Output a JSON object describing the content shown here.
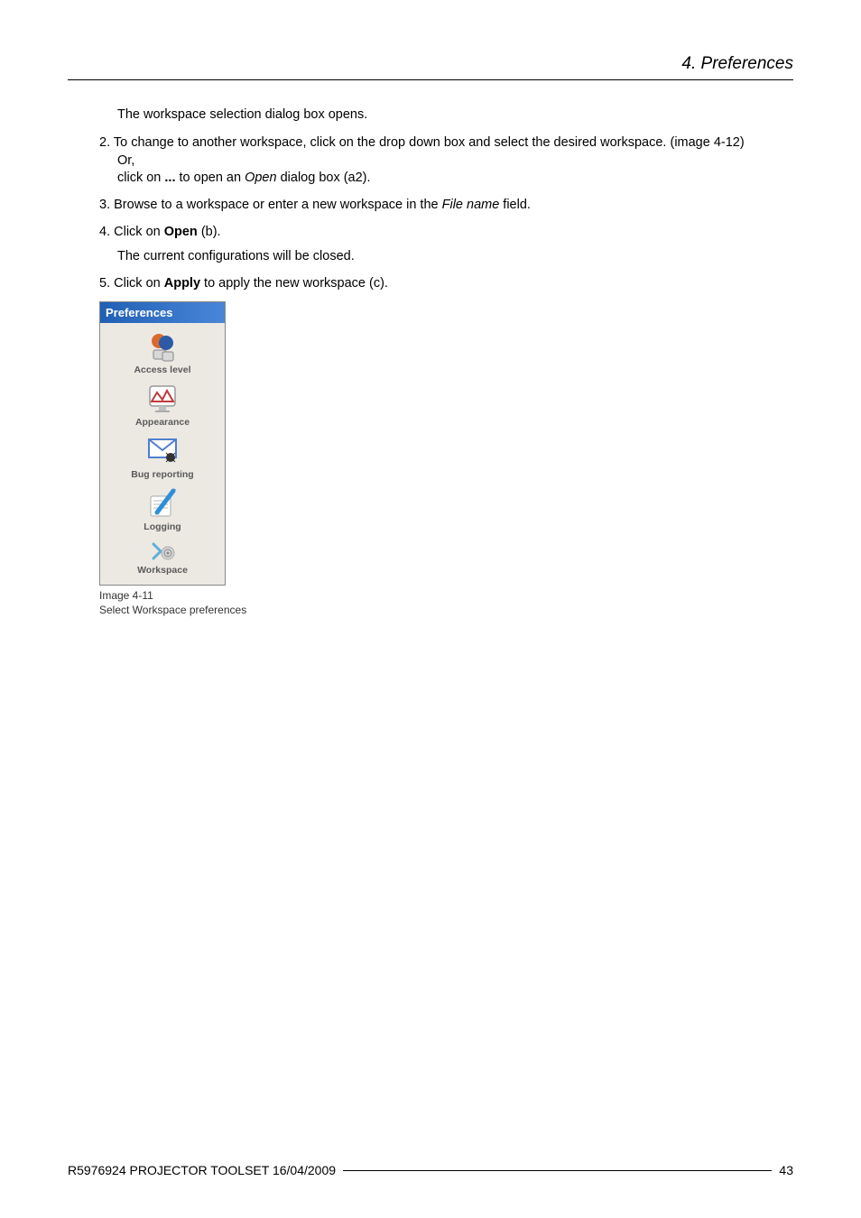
{
  "header": {
    "title": "4.  Preferences"
  },
  "intro": "The workspace selection dialog box opens.",
  "steps": {
    "s2": {
      "num": "2.",
      "text_a": "To change to another workspace, click on the drop down box and select the desired workspace.  (image 4-12)",
      "text_b": "Or,",
      "text_c_pre": "click on ",
      "text_c_bold": "...",
      "text_c_post1": "  to open an ",
      "text_c_ital": "Open",
      "text_c_post2": " dialog box (a2)."
    },
    "s3": {
      "num": "3.",
      "text_pre": "Browse to a workspace or enter a new workspace in the ",
      "text_ital": "File name",
      "text_post": " field."
    },
    "s4": {
      "num": "4.",
      "text_pre": "Click on ",
      "text_bold": "Open",
      "text_post": " (b).",
      "sub": "The current configurations will be closed."
    },
    "s5": {
      "num": "5.",
      "text_pre": "Click on ",
      "text_bold": "Apply",
      "text_post": " to apply the new workspace (c)."
    }
  },
  "prefs": {
    "title": "Preferences",
    "items": {
      "access": "Access level",
      "appearance": "Appearance",
      "bug": "Bug reporting",
      "logging": "Logging",
      "workspace": "Workspace"
    }
  },
  "caption": {
    "line1": "Image 4-11",
    "line2": "Select Workspace preferences"
  },
  "footer": {
    "left": "R5976924  PROJECTOR TOOLSET  16/04/2009",
    "page": "43"
  }
}
